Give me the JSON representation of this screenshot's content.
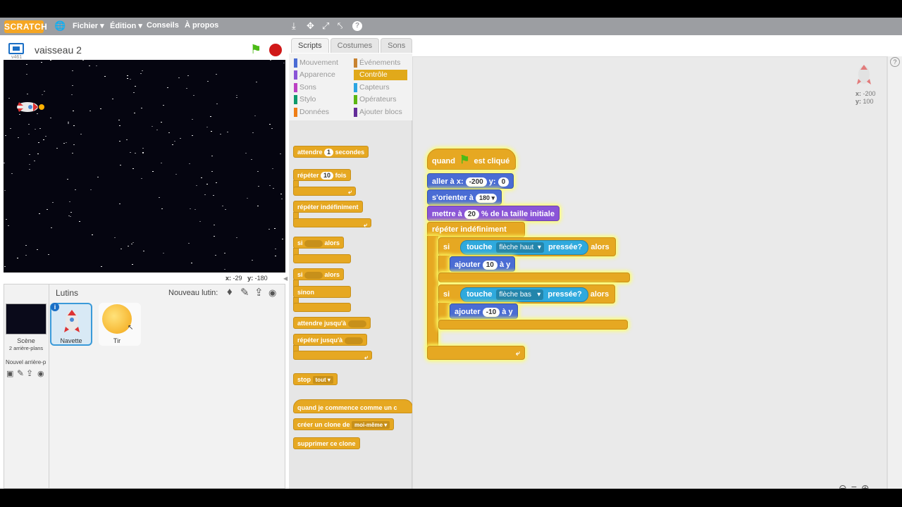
{
  "menubar": {
    "logo": "SCRATCH",
    "menus": [
      "Fichier ▾",
      "Édition ▾",
      "Conseils",
      "À propos"
    ],
    "tools": [
      "duplicate-icon",
      "delete-icon",
      "grow-icon",
      "shrink-icon",
      "help-icon"
    ]
  },
  "stage": {
    "sprite_name": "vaisseau 2",
    "version": "v461",
    "mouse_x_label": "x:",
    "mouse_x": "-29",
    "mouse_y_label": "y:",
    "mouse_y": "-180"
  },
  "sprites_panel": {
    "title": "Lutins",
    "new_sprite_label": "Nouveau lutin:",
    "scene_label": "Scène",
    "scene_backdrops": "2 arrière-plans",
    "new_backdrop_label": "Nouvel arrière-p",
    "sprites": [
      {
        "name": "Navette"
      },
      {
        "name": "Tir"
      }
    ]
  },
  "tabs": [
    "Scripts",
    "Costumes",
    "Sons"
  ],
  "categories": {
    "left": [
      {
        "label": "Mouvement",
        "color": "#4a6cd4"
      },
      {
        "label": "Apparence",
        "color": "#8a55d7"
      },
      {
        "label": "Sons",
        "color": "#bb42c3"
      },
      {
        "label": "Stylo",
        "color": "#0e9a6c"
      },
      {
        "label": "Données",
        "color": "#ee7d16"
      }
    ],
    "right": [
      {
        "label": "Événements",
        "color": "#c88330"
      },
      {
        "label": "Contrôle",
        "color": "#e1a91a"
      },
      {
        "label": "Capteurs",
        "color": "#2ca5e2"
      },
      {
        "label": "Opérateurs",
        "color": "#5cb712"
      },
      {
        "label": "Ajouter blocs",
        "color": "#632d99"
      }
    ]
  },
  "palette": {
    "wait_a": "attendre",
    "wait_num": "1",
    "wait_b": "secondes",
    "repeat_a": "répéter",
    "repeat_num": "10",
    "repeat_b": "fois",
    "forever": "répéter indéfiniment",
    "if_a": "si",
    "if_b": "alors",
    "if2_a": "si",
    "if2_b": "alors",
    "else": "sinon",
    "wait_until": "attendre jusqu'à",
    "repeat_until": "répéter jusqu'à",
    "stop": "stop",
    "stop_opt": "tout",
    "clone_start": "quand je commence comme un c",
    "create_clone": "créer un clone de",
    "create_clone_opt": "moi-même",
    "delete_clone": "supprimer ce clone"
  },
  "script": {
    "hat_a": "quand",
    "hat_b": "est cliqué",
    "goto_a": "aller à x:",
    "goto_x": "-200",
    "goto_b": "y:",
    "goto_y": "0",
    "point_a": "s'orienter à",
    "point_dir": "180",
    "size_a": "mettre à",
    "size_num": "20",
    "size_b": "% de la taille initiale",
    "forever": "répéter indéfiniment",
    "if1_a": "si",
    "if1_touch": "touche",
    "if1_key": "flèche haut",
    "if1_pressed": "pressée?",
    "if1_then": "alors",
    "add1_a": "ajouter",
    "add1_num": "10",
    "add1_b": "à y",
    "if2_a": "si",
    "if2_touch": "touche",
    "if2_key": "flèche bas",
    "if2_pressed": "pressée?",
    "if2_then": "alors",
    "add2_a": "ajouter",
    "add2_num": "-10",
    "add2_b": "à y"
  },
  "sprite_info": {
    "x_label": "x:",
    "x": "-200",
    "y_label": "y:",
    "y": "100"
  },
  "zoom": [
    "zoom-out-icon",
    "zoom-reset-icon",
    "zoom-in-icon"
  ]
}
